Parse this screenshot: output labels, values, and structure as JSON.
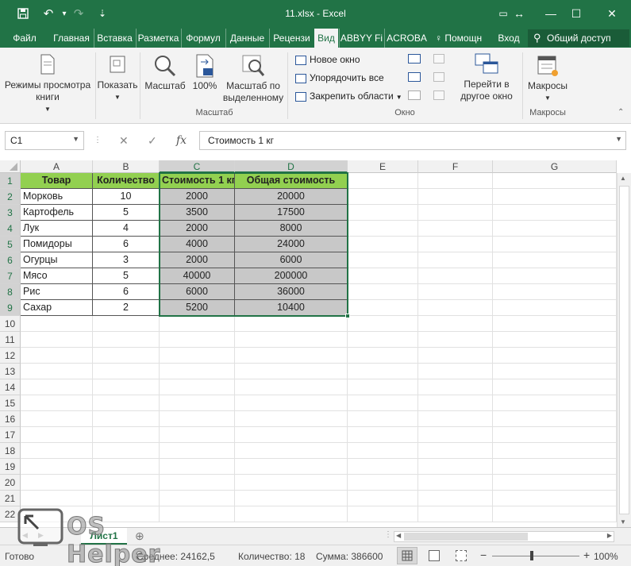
{
  "window": {
    "title": "11.xlsx - Excel",
    "undo_glyph": "↶",
    "redo_glyph": "↷",
    "qat_more_glyph": "⇣",
    "restore_glyph": "▭",
    "resize_glyph": "↔",
    "minimize_glyph": "—",
    "maximize_glyph": "☐",
    "close_glyph": "✕"
  },
  "tabs": [
    "Файл",
    "Главная",
    "Вставка",
    "Разметка",
    "Формул",
    "Данные",
    "Рецензи",
    "Вид",
    "ABBYY Fi",
    "ACROBA"
  ],
  "active_tab": "Вид",
  "tell_me": "Помощн",
  "sign_in": "Вход",
  "share": "Общий доступ",
  "ribbon": {
    "book_views": "Режимы просмотра книги",
    "show": "Показать",
    "zoom": "Масштаб",
    "zoom100": "100%",
    "zoom_selection": "Масштаб по выделенному",
    "zoom_group": "Масштаб",
    "new_window": "Новое окно",
    "arrange_all": "Упорядочить все",
    "freeze_panes": "Закрепить области",
    "switch_windows": "Перейти в другое окно",
    "window_group": "Окно",
    "macros": "Макросы",
    "macros_group": "Макросы"
  },
  "formula_bar": {
    "name_box": "C1",
    "fx": "fx",
    "content": "Стоимость 1 кг"
  },
  "columns": [
    "A",
    "B",
    "C",
    "D",
    "E",
    "F",
    "G"
  ],
  "row_numbers": [
    "1",
    "2",
    "3",
    "4",
    "5",
    "6",
    "7",
    "8",
    "9",
    "10",
    "11",
    "12",
    "13",
    "14",
    "15",
    "16",
    "17",
    "18",
    "19",
    "20",
    "21",
    "22"
  ],
  "table": {
    "headers": [
      "Товар",
      "Количество",
      "Стоимость 1 кг",
      "Общая стоимость"
    ],
    "rows": [
      [
        "Морковь",
        "10",
        "2000",
        "20000"
      ],
      [
        "Картофель",
        "5",
        "3500",
        "17500"
      ],
      [
        "Лук",
        "4",
        "2000",
        "8000"
      ],
      [
        "Помидоры",
        "6",
        "4000",
        "24000"
      ],
      [
        "Огурцы",
        "3",
        "2000",
        "6000"
      ],
      [
        "Мясо",
        "5",
        "40000",
        "200000"
      ],
      [
        "Рис",
        "6",
        "6000",
        "36000"
      ],
      [
        "Сахар",
        "2",
        "5200",
        "10400"
      ]
    ]
  },
  "sheet_tab": "Лист1",
  "status": {
    "ready": "Готово",
    "average": "Среднее: 24162,5",
    "count": "Количество: 18",
    "sum": "Сумма: 386600",
    "zoom": "100%"
  },
  "watermark": "OS Helper",
  "colors": {
    "excel_green": "#217346",
    "header_fill": "#92d050",
    "selection_fill": "#c8c8c8"
  }
}
